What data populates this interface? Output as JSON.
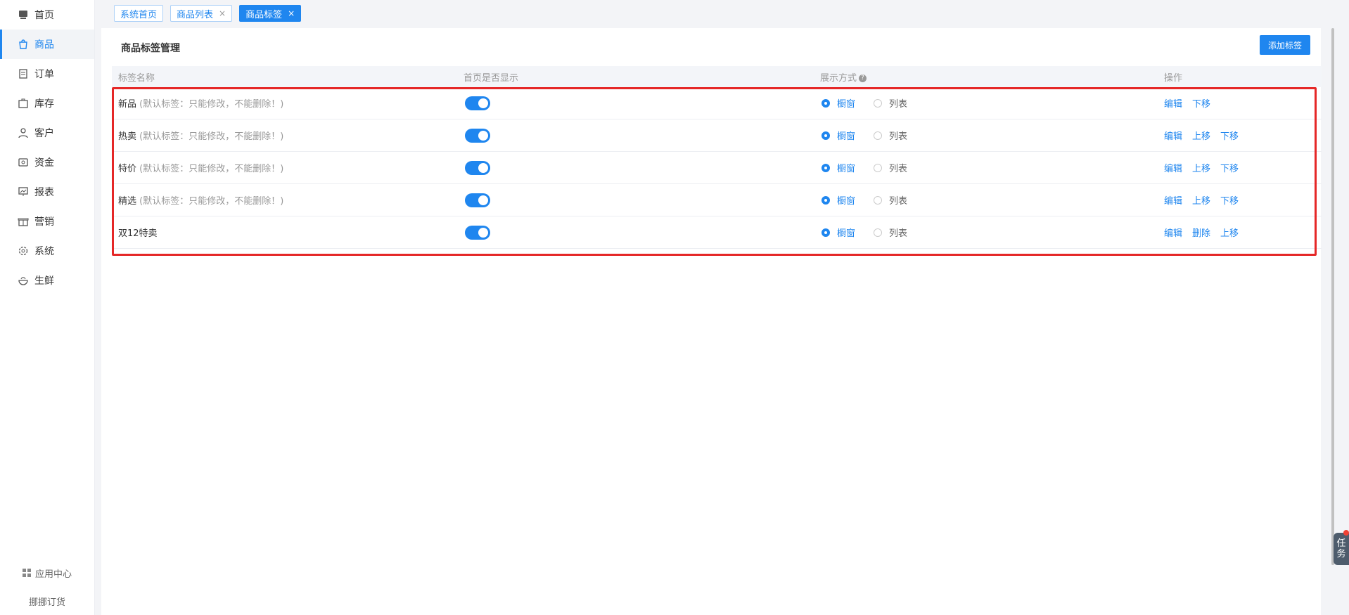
{
  "sidebar": {
    "items": [
      {
        "label": "首页",
        "icon": "home-icon"
      },
      {
        "label": "商品",
        "icon": "shopping-bag-icon",
        "active": true
      },
      {
        "label": "订单",
        "icon": "document-icon"
      },
      {
        "label": "库存",
        "icon": "box-icon"
      },
      {
        "label": "客户",
        "icon": "user-icon"
      },
      {
        "label": "资金",
        "icon": "wallet-icon"
      },
      {
        "label": "报表",
        "icon": "chart-board-icon"
      },
      {
        "label": "营销",
        "icon": "gift-icon"
      },
      {
        "label": "系统",
        "icon": "gear-icon"
      },
      {
        "label": "生鲜",
        "icon": "bowl-icon"
      }
    ],
    "app_center": "应用中心",
    "brand": "挪挪订货"
  },
  "tabs": [
    {
      "label": "系统首页",
      "closable": false
    },
    {
      "label": "商品列表",
      "closable": true
    },
    {
      "label": "商品标签",
      "closable": true,
      "active": true
    }
  ],
  "close_glyph": "×",
  "page": {
    "title": "商品标签管理",
    "add_button": "添加标签"
  },
  "table": {
    "headers": {
      "name": "标签名称",
      "show_home": "首页是否显示",
      "display_mode": "展示方式",
      "actions": "操作"
    },
    "help_glyph": "?",
    "option_window": "橱窗",
    "option_list": "列表",
    "rows": [
      {
        "name": "新品",
        "note": "(默认标签：只能修改，不能删除！)",
        "actions": [
          "编辑",
          "下移"
        ]
      },
      {
        "name": "热卖",
        "note": "(默认标签：只能修改，不能删除！)",
        "actions": [
          "编辑",
          "上移",
          "下移"
        ]
      },
      {
        "name": "特价",
        "note": "(默认标签：只能修改，不能删除！)",
        "actions": [
          "编辑",
          "上移",
          "下移"
        ]
      },
      {
        "name": "精选",
        "note": "(默认标签：只能修改，不能删除！)",
        "actions": [
          "编辑",
          "上移",
          "下移"
        ]
      },
      {
        "name": "双12特卖",
        "note": "",
        "actions": [
          "编辑",
          "删除",
          "上移"
        ]
      }
    ]
  },
  "task_widget": {
    "line1": "任",
    "line2": "务"
  },
  "colors": {
    "accent": "#1f86ef",
    "highlight": "#e52727"
  }
}
